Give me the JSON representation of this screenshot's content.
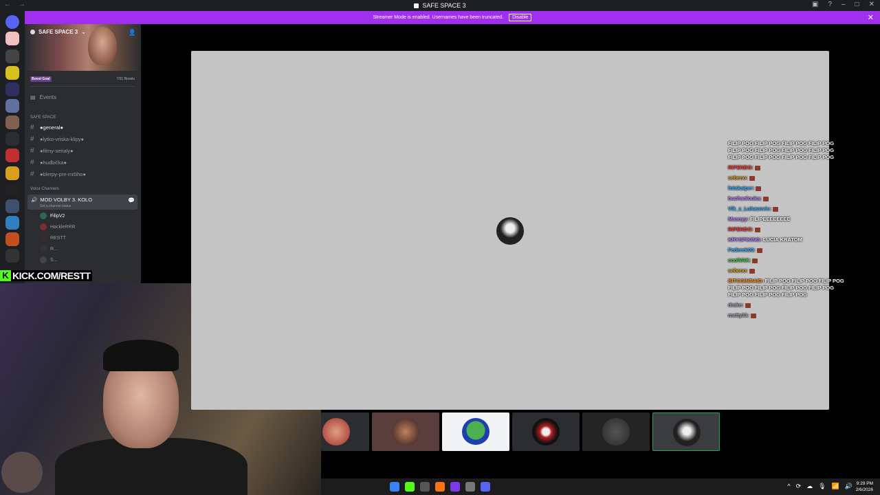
{
  "window": {
    "title": "SAFE SPACE 3",
    "nav_glyphs": "← →",
    "controls": [
      "▣",
      "?",
      "–",
      "□",
      "✕"
    ]
  },
  "banner": {
    "text": "Streamer Mode is enabled. Usernames have been truncated.",
    "disable_label": "Disable",
    "close_glyph": "✕"
  },
  "server": {
    "name": "SAFE SPACE 3",
    "boost_goal_label": "Boost Goal",
    "boost_count": "7/31 Boosts",
    "events_label": "Events",
    "category_text": "SAFE SPACE",
    "text_channels": [
      {
        "label": "●general●",
        "active": true
      },
      {
        "label": "●lytko-vriska-klipy●",
        "active": false
      },
      {
        "label": "●filmy-serialy●",
        "active": false
      },
      {
        "label": "●hudbička●",
        "active": false
      },
      {
        "label": "●blerpy-pre-mišiho●",
        "active": false
      }
    ],
    "voice_category": "Voice Channels",
    "voice_channel": {
      "name": "MOD VOLBY 3. KOLO",
      "status_placeholder": "Set a channel status"
    },
    "members": [
      "FilipV2",
      "HackleRRR",
      "RESTT",
      "R...",
      "S..."
    ]
  },
  "overlay": {
    "kick_letter": "K",
    "kick_text": "KICK.COM/RESTT"
  },
  "chat": [
    {
      "user": "",
      "text": "FILIP POG FILIP POG FILIP POG FILIP POG FILIP POG FILIP POG FILIP POG FILIP POG FILIP POG FILIP POG FILIP POG FILIP POG",
      "color": "#ffffff"
    },
    {
      "user": "RIPENDO:",
      "text": "",
      "color": "#ff3b3b"
    },
    {
      "user": "sebeno:",
      "text": "",
      "color": "#d4a020"
    },
    {
      "user": "fotakaiper:",
      "text": "",
      "color": "#3ab0ff"
    },
    {
      "user": "buchaolouka:",
      "text": "",
      "color": "#b080ff"
    },
    {
      "user": "Vlk_z_Luhacovic:",
      "text": "",
      "color": "#3ab0ff"
    },
    {
      "user": "Maaoyy:",
      "text": "FILIPEEEEEEEE",
      "color": "#b080ff"
    },
    {
      "user": "RIPENDO:",
      "text": "",
      "color": "#ff3b3b"
    },
    {
      "user": "KRYSPIKING:",
      "text": "LUCIA KRATOM",
      "color": "#b080ff"
    },
    {
      "user": "Federek00:",
      "text": "",
      "color": "#3ab0ff"
    },
    {
      "user": "coolVAK:",
      "text": "",
      "color": "#40d040"
    },
    {
      "user": "sebeno:",
      "text": "",
      "color": "#d4a020"
    },
    {
      "user": "BITCOINRAID:",
      "text": "FILIP POG FILIP POG FILIP POG FILIP POG FILIP POG FILIP POG FILIP POG FILIP POG FILIP POG FILIP POG",
      "color": "#ff9020"
    },
    {
      "user": "drake:",
      "text": "",
      "color": "#9aa0b0"
    },
    {
      "user": "matty31:",
      "text": "",
      "color": "#9aa0b0"
    }
  ],
  "taskbar": {
    "tray": [
      "^",
      "⟳",
      "☁",
      "🎙",
      "📶",
      "🔊"
    ],
    "time": "9:29 PM",
    "date": "2/6/2026"
  }
}
